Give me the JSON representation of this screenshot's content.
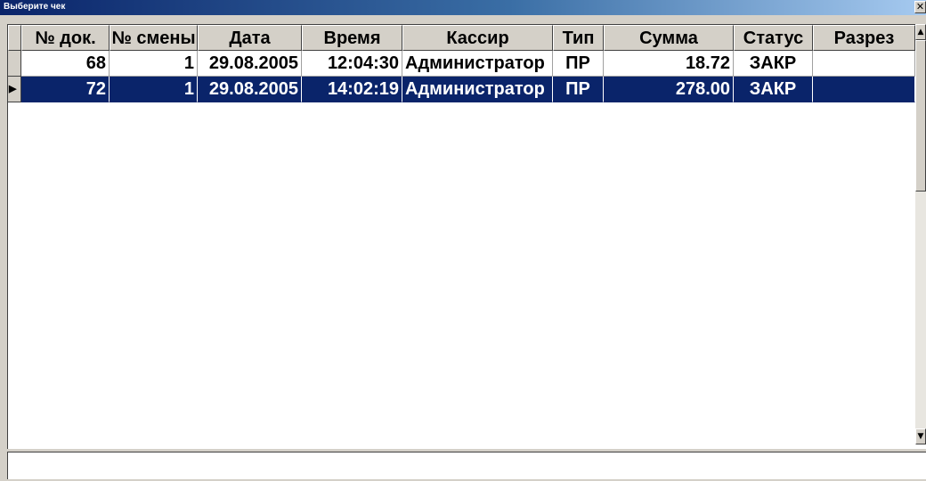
{
  "window": {
    "title": "Выберите чек",
    "close_glyph": "✕"
  },
  "grid": {
    "columns": [
      "№ док.",
      "№ смены",
      "Дата",
      "Время",
      "Кассир",
      "Тип",
      "Сумма",
      "Статус",
      "Разрез"
    ],
    "rows": [
      {
        "doc": "68",
        "shift": "1",
        "date": "29.08.2005",
        "time": "12:04:30",
        "cashier": "Администратор",
        "type": "ПР",
        "sum": "18.72",
        "status": "ЗАКР",
        "section": "",
        "selected": false
      },
      {
        "doc": "72",
        "shift": "1",
        "date": "29.08.2005",
        "time": "14:02:19",
        "cashier": "Администратор",
        "type": "ПР",
        "sum": "278.00",
        "status": "ЗАКР",
        "section": "",
        "selected": true
      }
    ],
    "row_indicator_glyph": "▶"
  },
  "scrollbar": {
    "up_glyph": "▲",
    "down_glyph": "▼"
  },
  "colors": {
    "selection": "#0a246a",
    "title_gradient_start": "#0a246a",
    "title_gradient_end": "#a6caf0",
    "face": "#d4d0c8"
  }
}
